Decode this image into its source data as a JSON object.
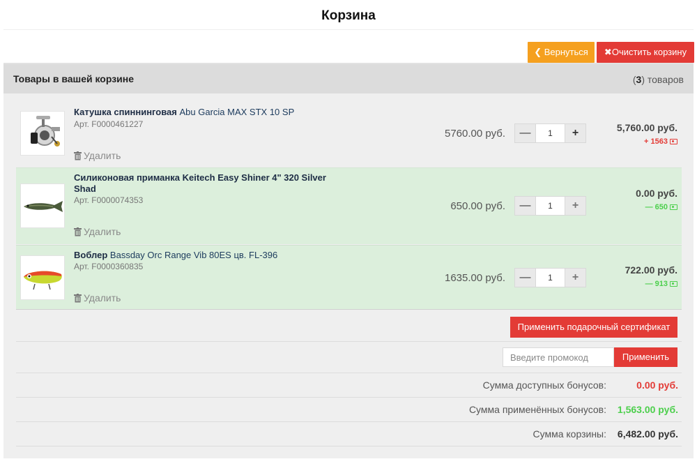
{
  "page": {
    "title": "Корзина"
  },
  "toolbar": {
    "back_label": "Вернуться",
    "clear_label": "Очистить корзину"
  },
  "cart": {
    "header_title": "Товары в вашей корзине",
    "count_prefix": "(",
    "count": "3",
    "count_suffix": ") товаров",
    "delete_label": "Удалить",
    "items": [
      {
        "name_bold": "Катушка спиннинговая",
        "name_rest": "Abu Garcia MAX STX 10 SP",
        "art": "Арт. F0000461227",
        "price": "5760.00 руб.",
        "qty": "1",
        "total": "5,760.00 руб.",
        "bonus_sign": "+",
        "bonus": "1563",
        "bonus_color": "#e33b36"
      },
      {
        "name_bold": "Силиконовая приманка",
        "name_rest": "Keitech Easy Shiner 4\" 320 Silver Shad",
        "art": "Арт. F0000074353",
        "price": "650.00 руб.",
        "qty": "1",
        "total": "0.00 руб.",
        "bonus_sign": "—",
        "bonus": "650",
        "bonus_color": "#4ccf4c"
      },
      {
        "name_bold": "Воблер",
        "name_rest": "Bassday Orc Range Vib 80ES цв. FL-396",
        "art": "Арт. F0000360835",
        "price": "1635.00 руб.",
        "qty": "1",
        "total": "722.00 руб.",
        "bonus_sign": "—",
        "bonus": "913",
        "bonus_color": "#4ccf4c"
      }
    ]
  },
  "gift_certificate": {
    "button_label": "Применить подарочный сертификат"
  },
  "promo": {
    "placeholder": "Введите промокод",
    "apply_label": "Применить"
  },
  "summary": {
    "available_label": "Сумма доступных бонусов:",
    "available_value": "0.00 руб.",
    "applied_label": "Сумма применённых бонусов:",
    "applied_value": "1,563.00 руб.",
    "total_label": "Сумма корзины:",
    "total_value": "6,482.00 руб."
  },
  "colors": {
    "accent_orange": "#f5a01f",
    "accent_red": "#e33b36",
    "bonus_green": "#4ccf4c",
    "row_green": "#dcefdc"
  }
}
